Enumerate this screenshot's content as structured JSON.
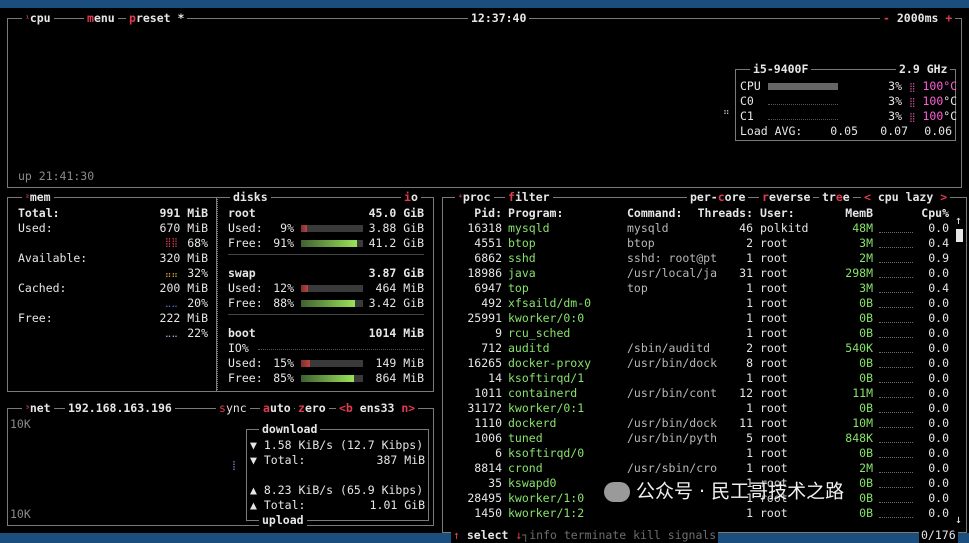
{
  "cpu_box": {
    "num": "¹",
    "title": "cpu",
    "menu": "menu",
    "preset": "preset *",
    "clock": "12:37:40",
    "minus": "-",
    "interval": "2000ms",
    "plus": "+",
    "uptime": "up 21:41:30",
    "model": "i5-9400F",
    "freq": "2.9 GHz",
    "rows": [
      {
        "label": "CPU",
        "pct": "3%",
        "fill": 1.0,
        "temp": "100",
        "unit": "°C"
      },
      {
        "label": "C0",
        "pct": "3%",
        "fill": 0.0,
        "temp": "100",
        "unit": "°C"
      },
      {
        "label": "C1",
        "pct": "3%",
        "fill": 0.0,
        "temp": "100",
        "unit": "°C"
      }
    ],
    "load_label": "Load AVG:",
    "load": [
      "0.05",
      "0.07",
      "0.06"
    ]
  },
  "mem": {
    "num": "²",
    "title": "mem",
    "total_label": "Total:",
    "total": "991 MiB",
    "used_label": "Used:",
    "used": "670 MiB",
    "used_pct": "68%",
    "avail_label": "Available:",
    "avail": "320 MiB",
    "avail_pct": "32%",
    "cached_label": "Cached:",
    "cached": "200 MiB",
    "cached_pct": "20%",
    "free_label": "Free:",
    "free": "222 MiB",
    "free_pct": "22%"
  },
  "disks": {
    "title": "disks",
    "io": "io",
    "root_name": "root",
    "root_size": "45.0 GiB",
    "root_used_label": "Used:",
    "root_used_pct": "9%",
    "root_used_fill": 0.09,
    "root_used": "3.88 GiB",
    "root_free_label": "Free:",
    "root_free_pct": "91%",
    "root_free_fill": 0.91,
    "root_free": "41.2 GiB",
    "swap_name": "swap",
    "swap_size": "3.87 GiB",
    "swap_used_label": "Used:",
    "swap_used_pct": "12%",
    "swap_used_fill": 0.12,
    "swap_used": "464 MiB",
    "swap_free_label": "Free:",
    "swap_free_pct": "88%",
    "swap_free_fill": 0.88,
    "swap_free": "3.42 GiB",
    "boot_name": "boot",
    "boot_size": "1014 MiB",
    "boot_io": "IO%",
    "boot_used_label": "Used:",
    "boot_used_pct": "15%",
    "boot_used_fill": 0.15,
    "boot_used": "149 MiB",
    "boot_free_label": "Free:",
    "boot_free_pct": "85%",
    "boot_free_fill": 0.85,
    "boot_free": "864 MiB"
  },
  "net": {
    "num": "³",
    "title": "net",
    "ip": "192.168.163.196",
    "sync": "sync",
    "auto": "auto",
    "zero": "zero",
    "iface_prev": "<b",
    "iface": "ens33",
    "iface_next": "n>",
    "scale_top": "10K",
    "scale_bottom": "10K",
    "download": "download",
    "dl_rate": "1.58 KiB/s (12.7 Kibps)",
    "dl_total_label": "Total:",
    "dl_total": "387 MiB",
    "ul_rate": "8.23 KiB/s (65.9 Kibps)",
    "ul_total_label": "Total:",
    "ul_total": "1.01 GiB",
    "upload": "upload"
  },
  "proc": {
    "num": "⁴",
    "title": "proc",
    "filter": "filter",
    "per_core": "per-core",
    "reverse": "reverse",
    "tree": "tree",
    "sort_prev": "<",
    "sort": "cpu lazy",
    "sort_next": ">",
    "headers": {
      "pid": "Pid:",
      "program": "Program:",
      "command": "Command:",
      "threads": "Threads:",
      "user": "User:",
      "mem": "MemB",
      "cpu": "Cpu%"
    },
    "rows": [
      {
        "pid": "16318",
        "program": "mysqld",
        "command": "mysqld",
        "threads": "46",
        "user": "polkitd",
        "mem": "48M",
        "cpu": "0.0"
      },
      {
        "pid": "4551",
        "program": "btop",
        "command": "btop",
        "threads": "2",
        "user": "root",
        "mem": "3M",
        "cpu": "0.4"
      },
      {
        "pid": "6862",
        "program": "sshd",
        "command": "sshd: root@pt",
        "threads": "1",
        "user": "root",
        "mem": "2M",
        "cpu": "0.9"
      },
      {
        "pid": "18986",
        "program": "java",
        "command": "/usr/local/ja",
        "threads": "31",
        "user": "root",
        "mem": "298M",
        "cpu": "0.0"
      },
      {
        "pid": "6947",
        "program": "top",
        "command": "top",
        "threads": "1",
        "user": "root",
        "mem": "3M",
        "cpu": "0.4"
      },
      {
        "pid": "492",
        "program": "xfsaild/dm-0",
        "command": "",
        "threads": "1",
        "user": "root",
        "mem": "0B",
        "cpu": "0.0"
      },
      {
        "pid": "25991",
        "program": "kworker/0:0",
        "command": "",
        "threads": "1",
        "user": "root",
        "mem": "0B",
        "cpu": "0.0"
      },
      {
        "pid": "9",
        "program": "rcu_sched",
        "command": "",
        "threads": "1",
        "user": "root",
        "mem": "0B",
        "cpu": "0.0"
      },
      {
        "pid": "712",
        "program": "auditd",
        "command": "/sbin/auditd",
        "threads": "2",
        "user": "root",
        "mem": "540K",
        "cpu": "0.0"
      },
      {
        "pid": "16265",
        "program": "docker-proxy",
        "command": "/usr/bin/dock",
        "threads": "8",
        "user": "root",
        "mem": "0B",
        "cpu": "0.0"
      },
      {
        "pid": "14",
        "program": "ksoftirqd/1",
        "command": "",
        "threads": "1",
        "user": "root",
        "mem": "0B",
        "cpu": "0.0"
      },
      {
        "pid": "1011",
        "program": "containerd",
        "command": "/usr/bin/cont",
        "threads": "12",
        "user": "root",
        "mem": "11M",
        "cpu": "0.0"
      },
      {
        "pid": "31172",
        "program": "kworker/0:1",
        "command": "",
        "threads": "1",
        "user": "root",
        "mem": "0B",
        "cpu": "0.0"
      },
      {
        "pid": "1110",
        "program": "dockerd",
        "command": "/usr/bin/dock",
        "threads": "11",
        "user": "root",
        "mem": "10M",
        "cpu": "0.0"
      },
      {
        "pid": "1006",
        "program": "tuned",
        "command": "/usr/bin/pyth",
        "threads": "5",
        "user": "root",
        "mem": "848K",
        "cpu": "0.0"
      },
      {
        "pid": "6",
        "program": "ksoftirqd/0",
        "command": "",
        "threads": "1",
        "user": "root",
        "mem": "0B",
        "cpu": "0.0"
      },
      {
        "pid": "8814",
        "program": "crond",
        "command": "/usr/sbin/cro",
        "threads": "1",
        "user": "root",
        "mem": "2M",
        "cpu": "0.0"
      },
      {
        "pid": "35",
        "program": "kswapd0",
        "command": "",
        "threads": "1",
        "user": "root",
        "mem": "0B",
        "cpu": "0.0"
      },
      {
        "pid": "28495",
        "program": "kworker/1:0",
        "command": "",
        "threads": "1",
        "user": "root",
        "mem": "0B",
        "cpu": "0.0"
      },
      {
        "pid": "1450",
        "program": "kworker/1:2",
        "command": "",
        "threads": "1",
        "user": "root",
        "mem": "0B",
        "cpu": "0.0"
      }
    ],
    "scroll_up": "↑",
    "scroll_down": "↓",
    "footer": {
      "up": "↑",
      "select": "select",
      "down": "↓",
      "info": "info",
      "terminate": "terminate",
      "kill": "kill",
      "signals": "signals",
      "count": "0/176"
    }
  },
  "watermark": "公众号 · 民工哥技术之路",
  "colors": {
    "accent": "#e03c50",
    "background": "#000000",
    "desktop": "#1c4e7d",
    "temp": "#ff5fd7",
    "program": "#87e36a"
  }
}
